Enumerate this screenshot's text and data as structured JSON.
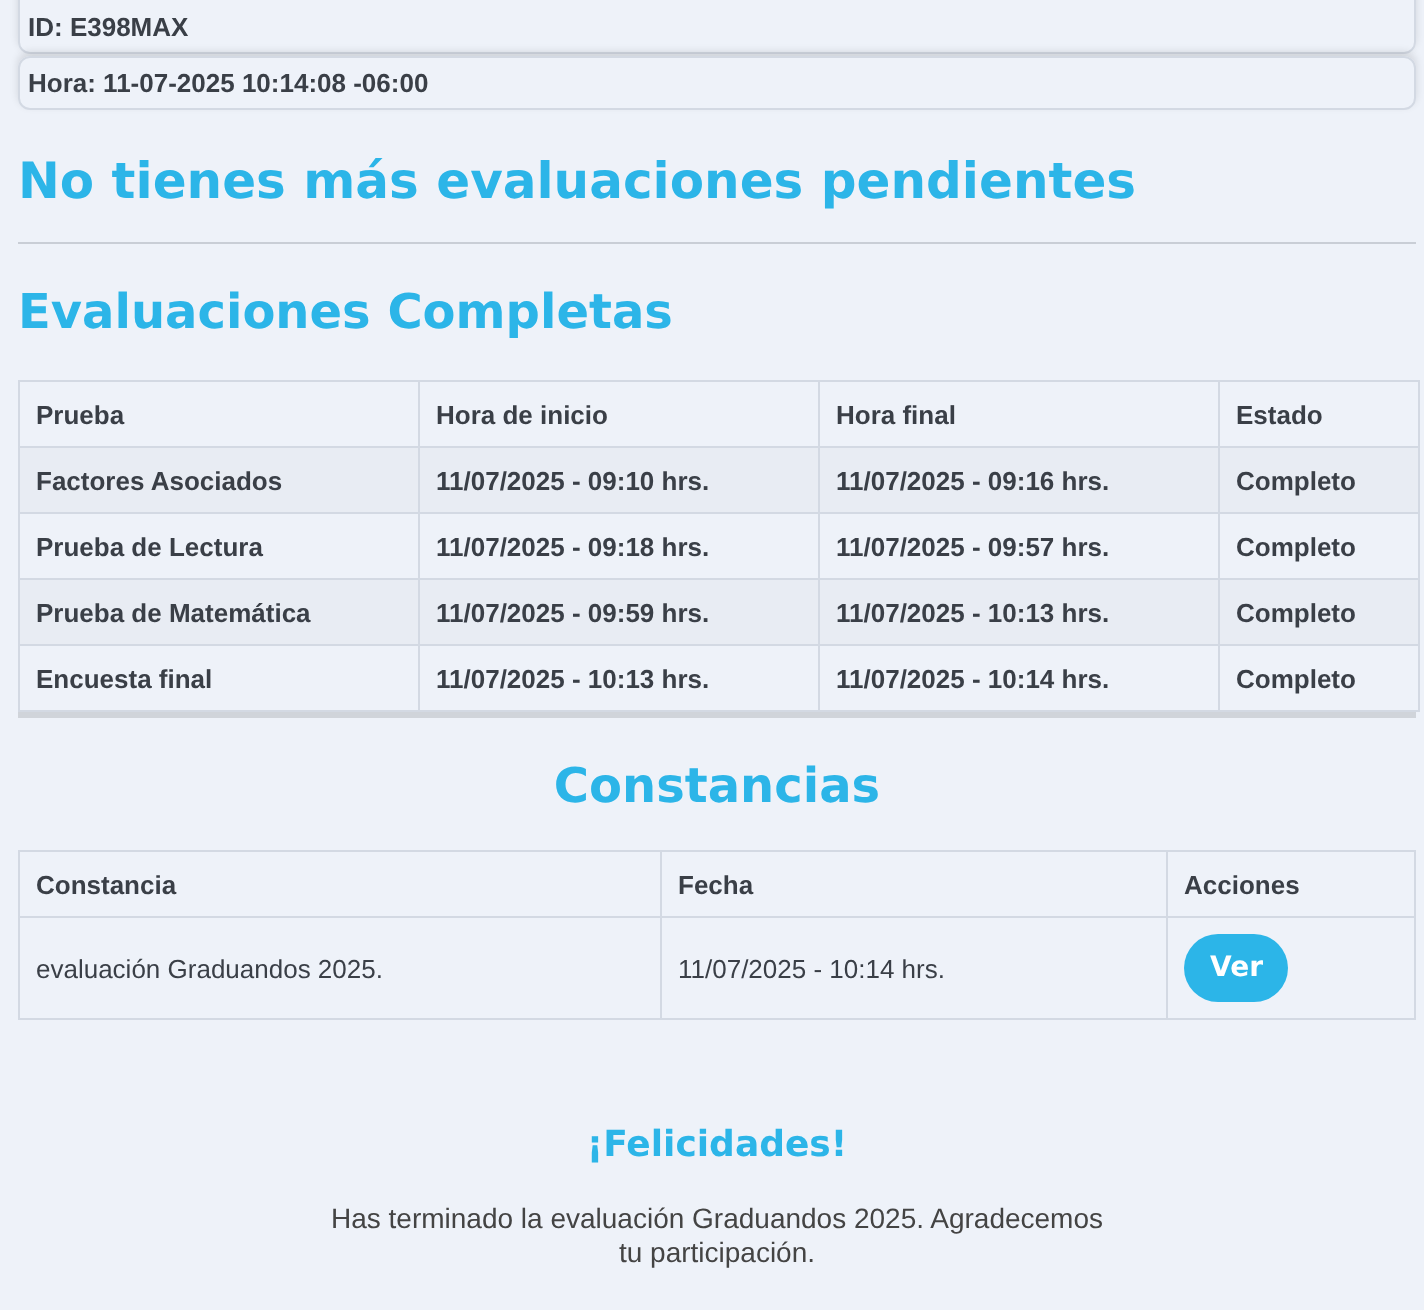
{
  "info": [
    "ID: E398MAX",
    "Hora: 11-07-2025 10:14:08 -06:00"
  ],
  "pending_title": "No tienes más evaluaciones pendientes",
  "completed": {
    "title": "Evaluaciones Completas",
    "columns": [
      "Prueba",
      "Hora de inicio",
      "Hora final",
      "Estado"
    ],
    "rows": [
      [
        "Factores Asociados",
        "11/07/2025 - 09:10 hrs.",
        "11/07/2025 - 09:16 hrs.",
        "Completo"
      ],
      [
        "Prueba de Lectura",
        "11/07/2025 - 09:18 hrs.",
        "11/07/2025 - 09:57 hrs.",
        "Completo"
      ],
      [
        "Prueba de Matemática",
        "11/07/2025 - 09:59 hrs.",
        "11/07/2025 - 10:13 hrs.",
        "Completo"
      ],
      [
        "Encuesta final",
        "11/07/2025 - 10:13 hrs.",
        "11/07/2025 - 10:14 hrs.",
        "Completo"
      ]
    ]
  },
  "certificates": {
    "title": "Constancias",
    "columns": [
      "Constancia",
      "Fecha",
      "Acciones"
    ],
    "rows": [
      {
        "name": "evaluación Graduandos 2025.",
        "date": "11/07/2025 - 10:14 hrs.",
        "action": "Ver"
      }
    ]
  },
  "congrats": {
    "title": "¡Felicidades!",
    "message": "Has terminado la evaluación Graduandos 2025. Agradecemos tu participación."
  }
}
